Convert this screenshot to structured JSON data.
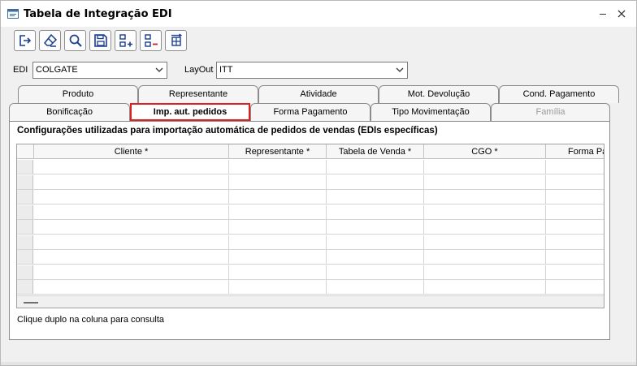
{
  "window": {
    "title": "Tabela de Integração EDI"
  },
  "toolbar": {
    "buttons": [
      {
        "icon": "exit-icon"
      },
      {
        "icon": "eraser-icon"
      },
      {
        "icon": "search-icon"
      },
      {
        "icon": "save-icon"
      },
      {
        "icon": "add-row-icon"
      },
      {
        "icon": "remove-row-icon"
      },
      {
        "icon": "transfer-icon"
      }
    ]
  },
  "filters": {
    "edi_label": "EDI",
    "edi_value": "COLGATE",
    "layout_label": "LayOut",
    "layout_value": "ITT"
  },
  "tabs_row1": [
    {
      "label": "Produto"
    },
    {
      "label": "Representante"
    },
    {
      "label": "Atividade"
    },
    {
      "label": "Mot. Devolução"
    },
    {
      "label": "Cond. Pagamento"
    }
  ],
  "tabs_row2": [
    {
      "label": "Bonificação"
    },
    {
      "label": "Imp. aut. pedidos"
    },
    {
      "label": "Forma Pagamento"
    },
    {
      "label": "Tipo Movimentação"
    },
    {
      "label": "Família"
    }
  ],
  "panel": {
    "title": "Configurações utilizadas para importação automática de pedidos de vendas (EDIs específicas)",
    "hint": "Clique duplo na coluna para consulta"
  },
  "grid": {
    "columns": [
      "Cliente *",
      "Representante *",
      "Tabela de Venda *",
      "CGO *",
      "Forma Pa"
    ],
    "row_count": 9
  },
  "colors": {
    "active_tab_border": "#e01e1e"
  }
}
